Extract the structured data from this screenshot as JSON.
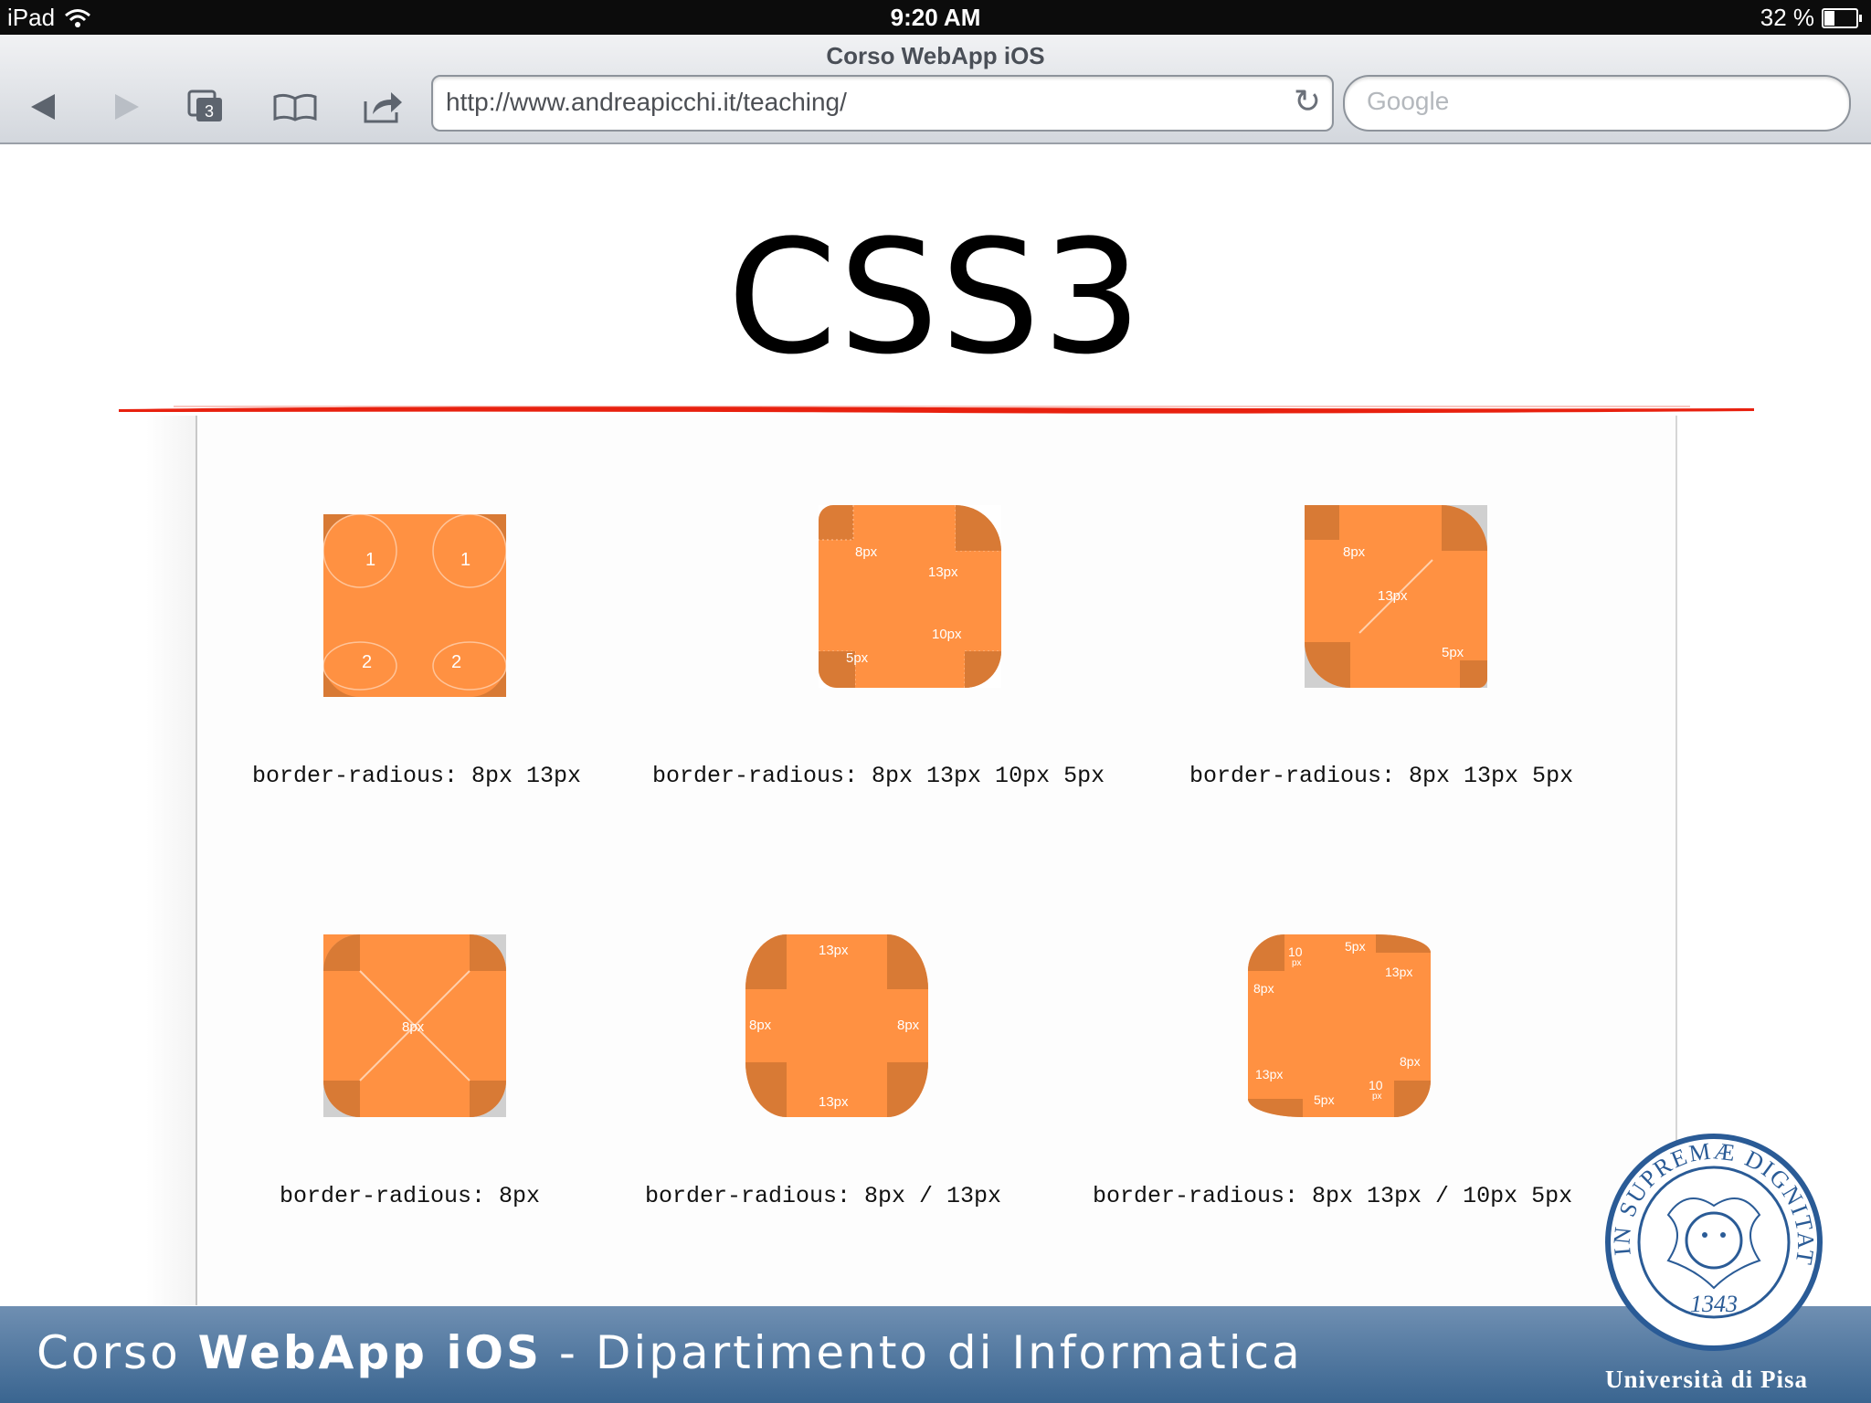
{
  "status_bar": {
    "device": "iPad",
    "time": "9:20 AM",
    "battery": "32 %",
    "battery_level": 0.32
  },
  "browser": {
    "title": "Corso WebApp iOS",
    "tab_count": "3",
    "url": "http://www.andreapicchi.it/teaching/",
    "search_placeholder": "Google"
  },
  "slide": {
    "title": "CSS3",
    "examples": [
      {
        "caption": "border-radious: 8px 13px",
        "labels": [
          "1",
          "1",
          "2",
          "2"
        ]
      },
      {
        "caption": "border-radious: 8px 13px 10px 5px",
        "labels": [
          "8px",
          "13px",
          "10px",
          "5px"
        ]
      },
      {
        "caption": "border-radious: 8px 13px 5px",
        "labels": [
          "8px",
          "13px",
          "5px"
        ]
      },
      {
        "caption": "border-radious: 8px",
        "labels": [
          "8px"
        ]
      },
      {
        "caption": "border-radious: 8px / 13px",
        "labels": [
          "13px",
          "8px",
          "8px",
          "13px"
        ]
      },
      {
        "caption": "border-radious: 8px 13px / 10px 5px",
        "labels": [
          "10",
          "px",
          "5px",
          "8px",
          "13px",
          "8px",
          "13px",
          "10",
          "px",
          "5px"
        ]
      }
    ]
  },
  "footer": {
    "prefix": "Corso ",
    "bold": "WebApp iOS",
    "suffix": " - Dipartimento di Informatica",
    "university": "Università di Pisa",
    "seal_top": "IN SUPREMÆ DIGNITATIS",
    "seal_year": "1343"
  },
  "colors": {
    "orange": "#ff9142",
    "orange_dark": "#d87a35",
    "red_line": "#e8210f",
    "footer_blue": "#3a6590"
  }
}
